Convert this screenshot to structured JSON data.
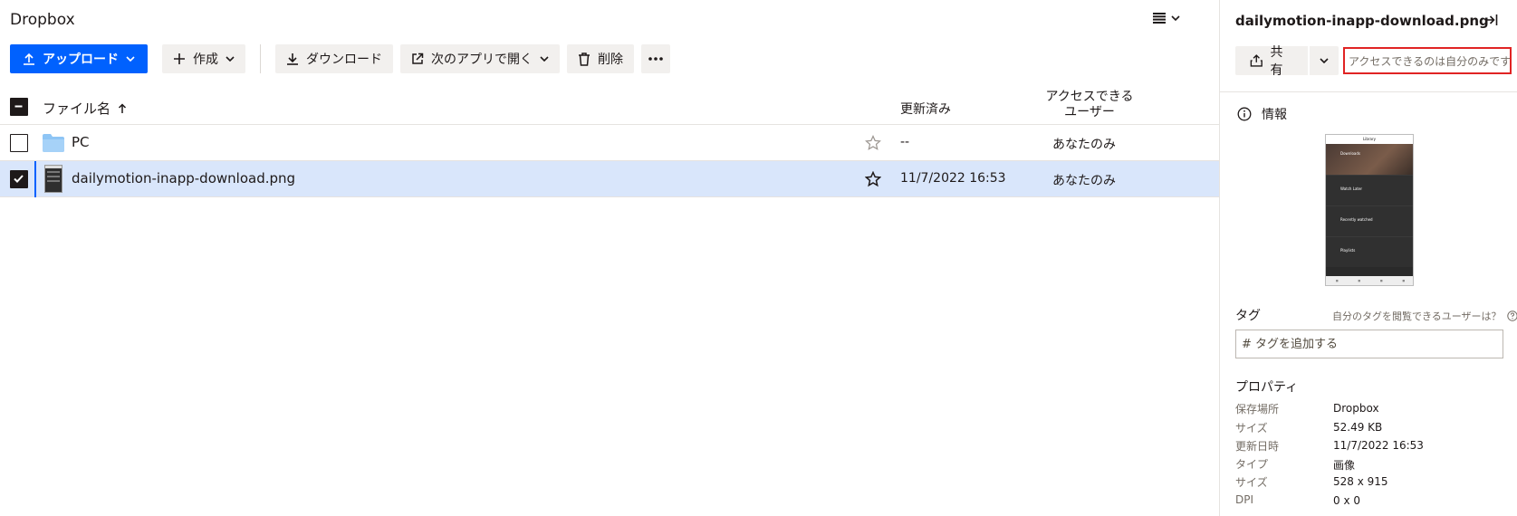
{
  "app": {
    "title": "Dropbox"
  },
  "toolbar": {
    "upload_label": "アップロード",
    "create_label": "作成",
    "download_label": "ダウンロード",
    "open_with_label": "次のアプリで開く",
    "delete_label": "削除"
  },
  "columns": {
    "name": "ファイル名",
    "modified": "更新済み",
    "access_line1": "アクセスできる",
    "access_line2": "ユーザー"
  },
  "files": [
    {
      "name": "PC",
      "type": "folder",
      "modified": "--",
      "access": "あなたのみ",
      "starred": false,
      "selected": false
    },
    {
      "name": "dailymotion-inapp-download.png",
      "type": "image",
      "modified": "11/7/2022 16:53",
      "access": "あなたのみ",
      "starred": false,
      "selected": true
    }
  ],
  "panel": {
    "title": "dailymotion-inapp-download.png",
    "share_label": "共有",
    "access_note": "アクセスできるのは自分のみです",
    "info_label": "情報",
    "thumbnail": {
      "header": "Library",
      "items": [
        "Downloads",
        "Watch Later",
        "Recently watched",
        "Playlists"
      ]
    },
    "tags": {
      "label": "タグ",
      "help": "自分のタグを閲覧できるユーザーは？",
      "placeholder": "# タグを追加する"
    },
    "properties": {
      "title": "プロパティ",
      "rows": [
        {
          "key": "保存場所",
          "value": "Dropbox"
        },
        {
          "key": "サイズ",
          "value": "52.49 KB"
        },
        {
          "key": "更新日時",
          "value": "11/7/2022 16:53"
        },
        {
          "key": "タイプ",
          "value": "画像"
        },
        {
          "key": "サイズ",
          "value": "528 x 915"
        },
        {
          "key": "DPI",
          "value": "0 x 0"
        }
      ]
    }
  },
  "colors": {
    "accent": "#0061fe",
    "selected_row": "#d9e6fb",
    "highlight_border": "#e02424",
    "folder": "#8ec5f5"
  }
}
